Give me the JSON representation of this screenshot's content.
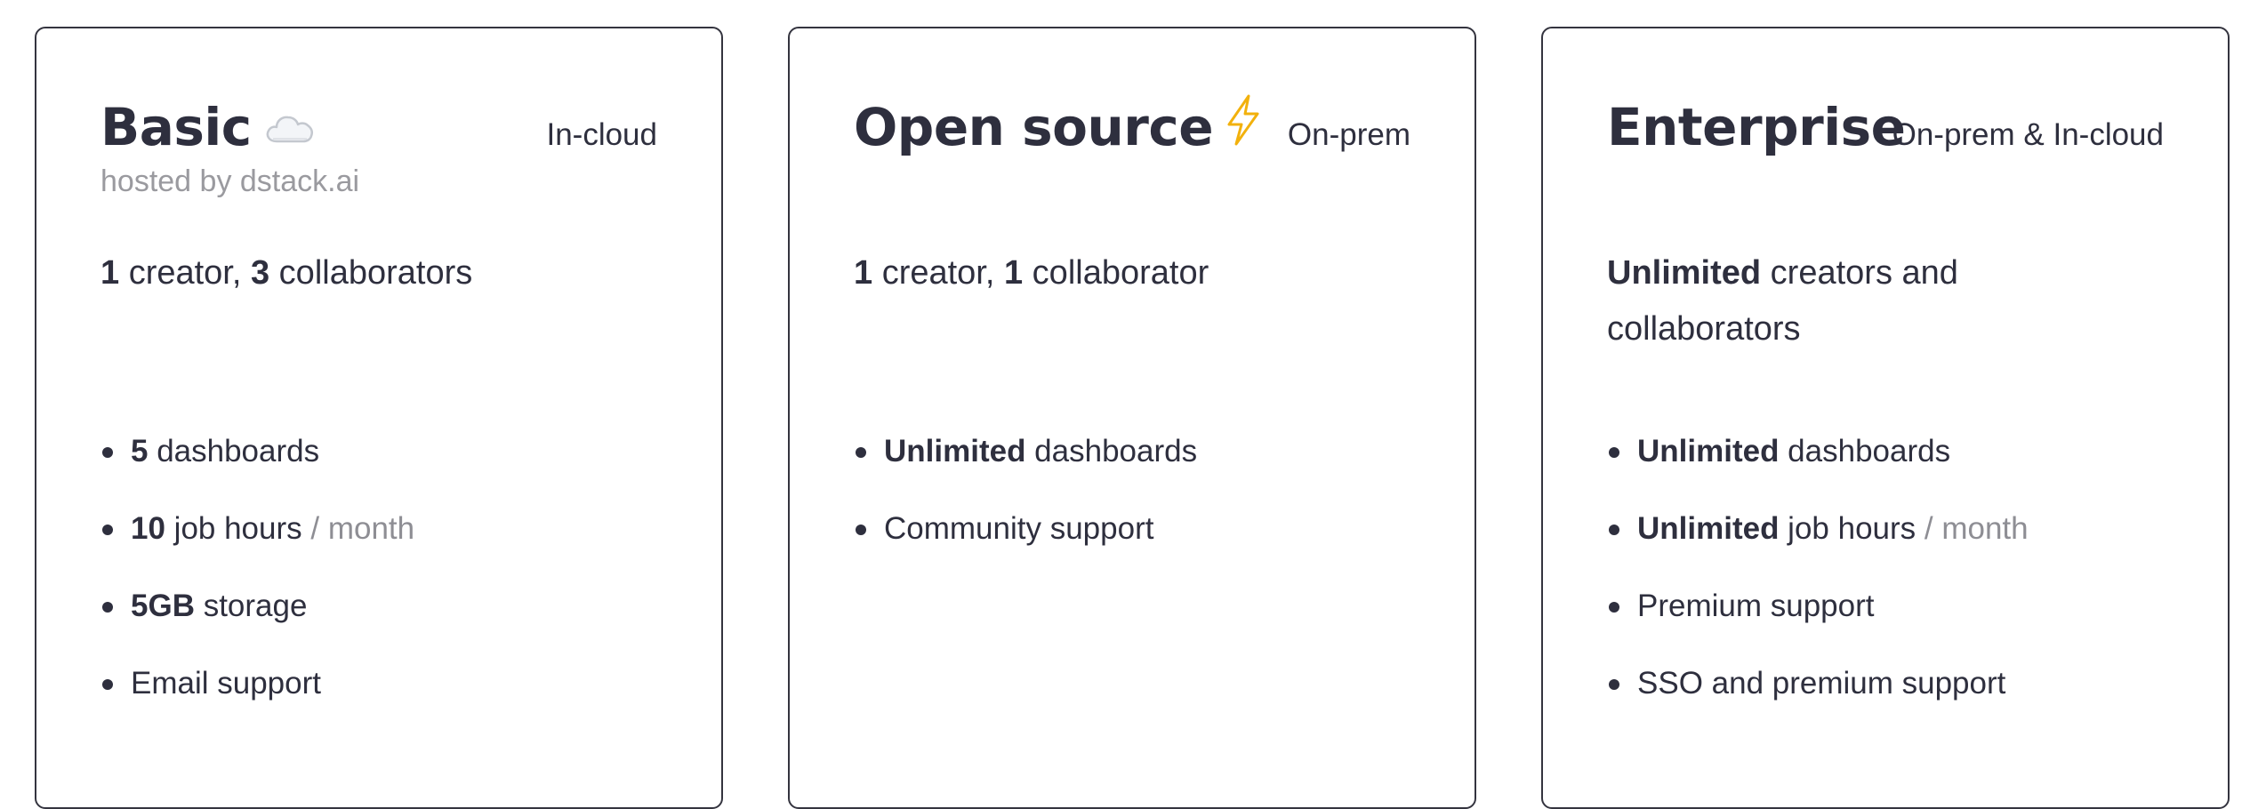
{
  "plans": [
    {
      "name": "Basic",
      "icon": "cloud-icon",
      "deployment": "In-cloud",
      "subtitle": "hosted by dstack.ai",
      "seats": {
        "creators_bold": "1",
        "creators_text": " creator, ",
        "collab_bold": "3",
        "collab_text": " collaborators"
      },
      "features": [
        {
          "bold": "5",
          "text": " dashboards",
          "suffix": ""
        },
        {
          "bold": "10",
          "text": " job hours",
          "suffix": " / month"
        },
        {
          "bold": "5GB",
          "text": " storage",
          "suffix": ""
        },
        {
          "bold": "",
          "text": "Email support",
          "suffix": ""
        }
      ]
    },
    {
      "name": "Open source",
      "icon": "lightning-icon",
      "deployment": "On-prem",
      "subtitle": "",
      "seats": {
        "creators_bold": "1",
        "creators_text": " creator, ",
        "collab_bold": "1",
        "collab_text": " collaborator"
      },
      "features": [
        {
          "bold": "Unlimited",
          "text": " dashboards",
          "suffix": ""
        },
        {
          "bold": "",
          "text": "Community support",
          "suffix": ""
        }
      ]
    },
    {
      "name": "Enterprise",
      "icon": "",
      "deployment": "On-prem & In-cloud",
      "subtitle": "",
      "seats": {
        "creators_bold": "Unlimited",
        "creators_text": " creators and collaborators",
        "collab_bold": "",
        "collab_text": ""
      },
      "features": [
        {
          "bold": "Unlimited",
          "text": " dashboards",
          "suffix": ""
        },
        {
          "bold": "Unlimited",
          "text": " job hours",
          "suffix": " / month"
        },
        {
          "bold": "",
          "text": "Premium support",
          "suffix": ""
        },
        {
          "bold": "",
          "text": "SSO and premium support",
          "suffix": ""
        }
      ]
    }
  ],
  "colors": {
    "text": "#2e2f3e",
    "muted": "#9a9a9f",
    "border": "#34343f",
    "lightning": "#f2b10c"
  }
}
